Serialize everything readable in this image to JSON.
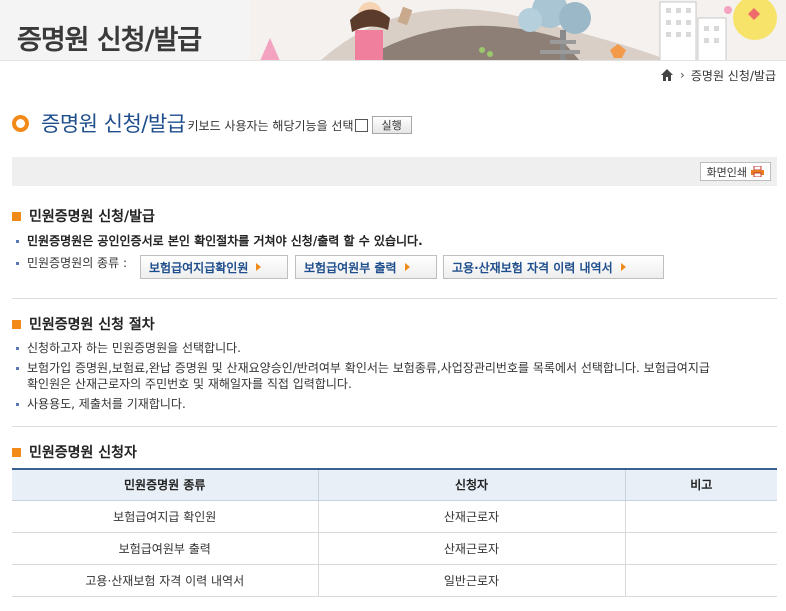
{
  "banner": {
    "title": "증명원 신청/발급"
  },
  "breadcrumb": {
    "current": "증명원 신청/발급"
  },
  "page": {
    "title": "증명원 신청/발급",
    "keyboard_notice": "키보드 사용자는 해당기능을 선택",
    "run_label": "실행"
  },
  "print": {
    "label": "화면인쇄"
  },
  "section1": {
    "title": "민원증명원 신청/발급",
    "line1": "민원증명원은 공인인증서로 본인 확인절차를 거쳐야 신청/출력 할 수 있습니다.",
    "line2_label": "민원증명원의 종류 :",
    "buttons": [
      "보험급여지급확인원",
      "보험급여원부 출력",
      "고용·산재보험 자격 이력 내역서"
    ]
  },
  "section2": {
    "title": "민원증명원 신청 절차",
    "line1": "신청하고자 하는 민원증명원을 선택합니다.",
    "line2a": "보험가입 증명원,보험료,완납 증명원 및 산재요양승인/반려여부 확인서는 보험종류,사업장관리번호를 목록에서 선택합니다. 보험급여지급",
    "line2b": "확인원은 산재근로자의 주민번호 및 재해일자를 직접 입력합니다.",
    "line3": "사용용도, 제출처를 기재합니다."
  },
  "section3": {
    "title": "민원증명원 신청자",
    "headers": [
      "민원증명원 종류",
      "신청자",
      "비고"
    ],
    "rows": [
      [
        "보험급여지급 확인원",
        "산재근로자",
        ""
      ],
      [
        "보험급여원부 출력",
        "산재근로자",
        ""
      ],
      [
        "고용·산재보험 자격 이력 내역서",
        "일반근로자",
        ""
      ]
    ]
  },
  "colors": {
    "accent": "#f28a1a",
    "title_blue": "#1f4e8c",
    "table_head": "#e8eff7"
  }
}
